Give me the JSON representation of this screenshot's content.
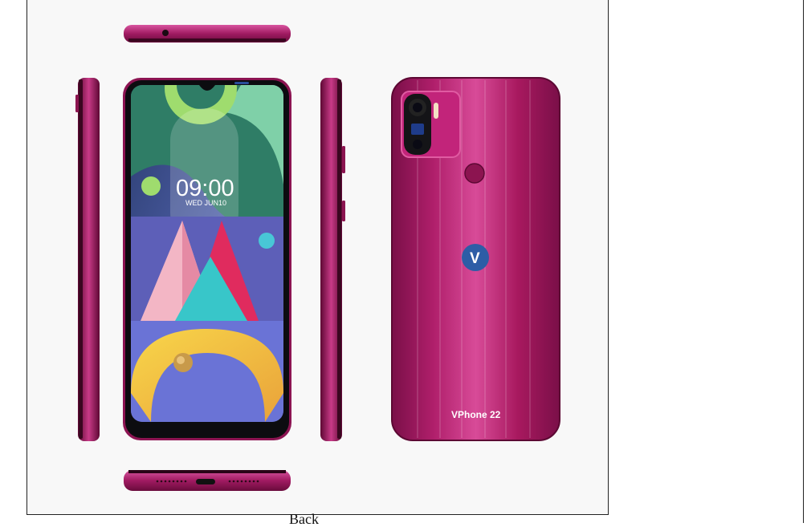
{
  "caption": "Back",
  "phone": {
    "model_label": "VPhone 22",
    "logo_letter": "V",
    "lockscreen_time": "09:00",
    "lockscreen_date": "WED JUN10",
    "body_color": "#a4185f",
    "body_color_dark": "#6e0b3f",
    "body_color_light": "#d24692"
  }
}
